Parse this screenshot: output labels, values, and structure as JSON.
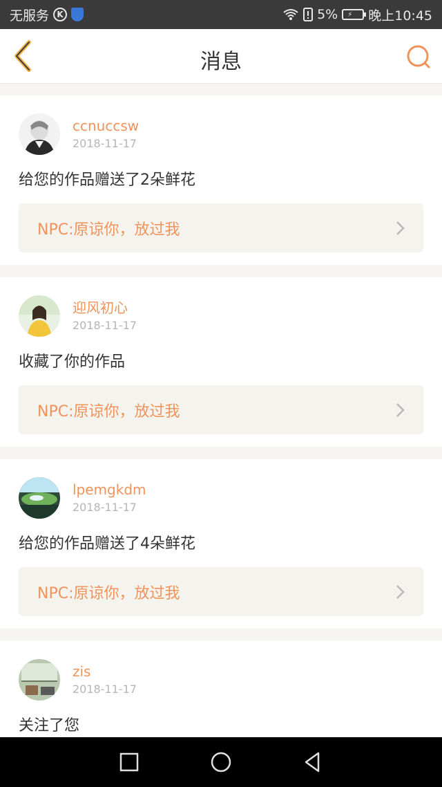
{
  "status": {
    "carrier": "无服务",
    "battery_pct": "5%",
    "time": "晚上10:45"
  },
  "header": {
    "title": "消息"
  },
  "colors": {
    "accent": "#f0935a",
    "shield": "#3a78d8"
  },
  "notifications": [
    {
      "user": "ccnuccsw",
      "date": "2018-11-17",
      "action": "给您的作品赠送了2朵鲜花",
      "work": "NPC:原谅你，放过我"
    },
    {
      "user": "迎风初心",
      "date": "2018-11-17",
      "action": "收藏了你的作品",
      "work": "NPC:原谅你，放过我"
    },
    {
      "user": "lpemgkdm",
      "date": "2018-11-17",
      "action": "给您的作品赠送了4朵鲜花",
      "work": "NPC:原谅你，放过我"
    },
    {
      "user": "zis",
      "date": "2018-11-17",
      "action": "关注了您"
    }
  ]
}
